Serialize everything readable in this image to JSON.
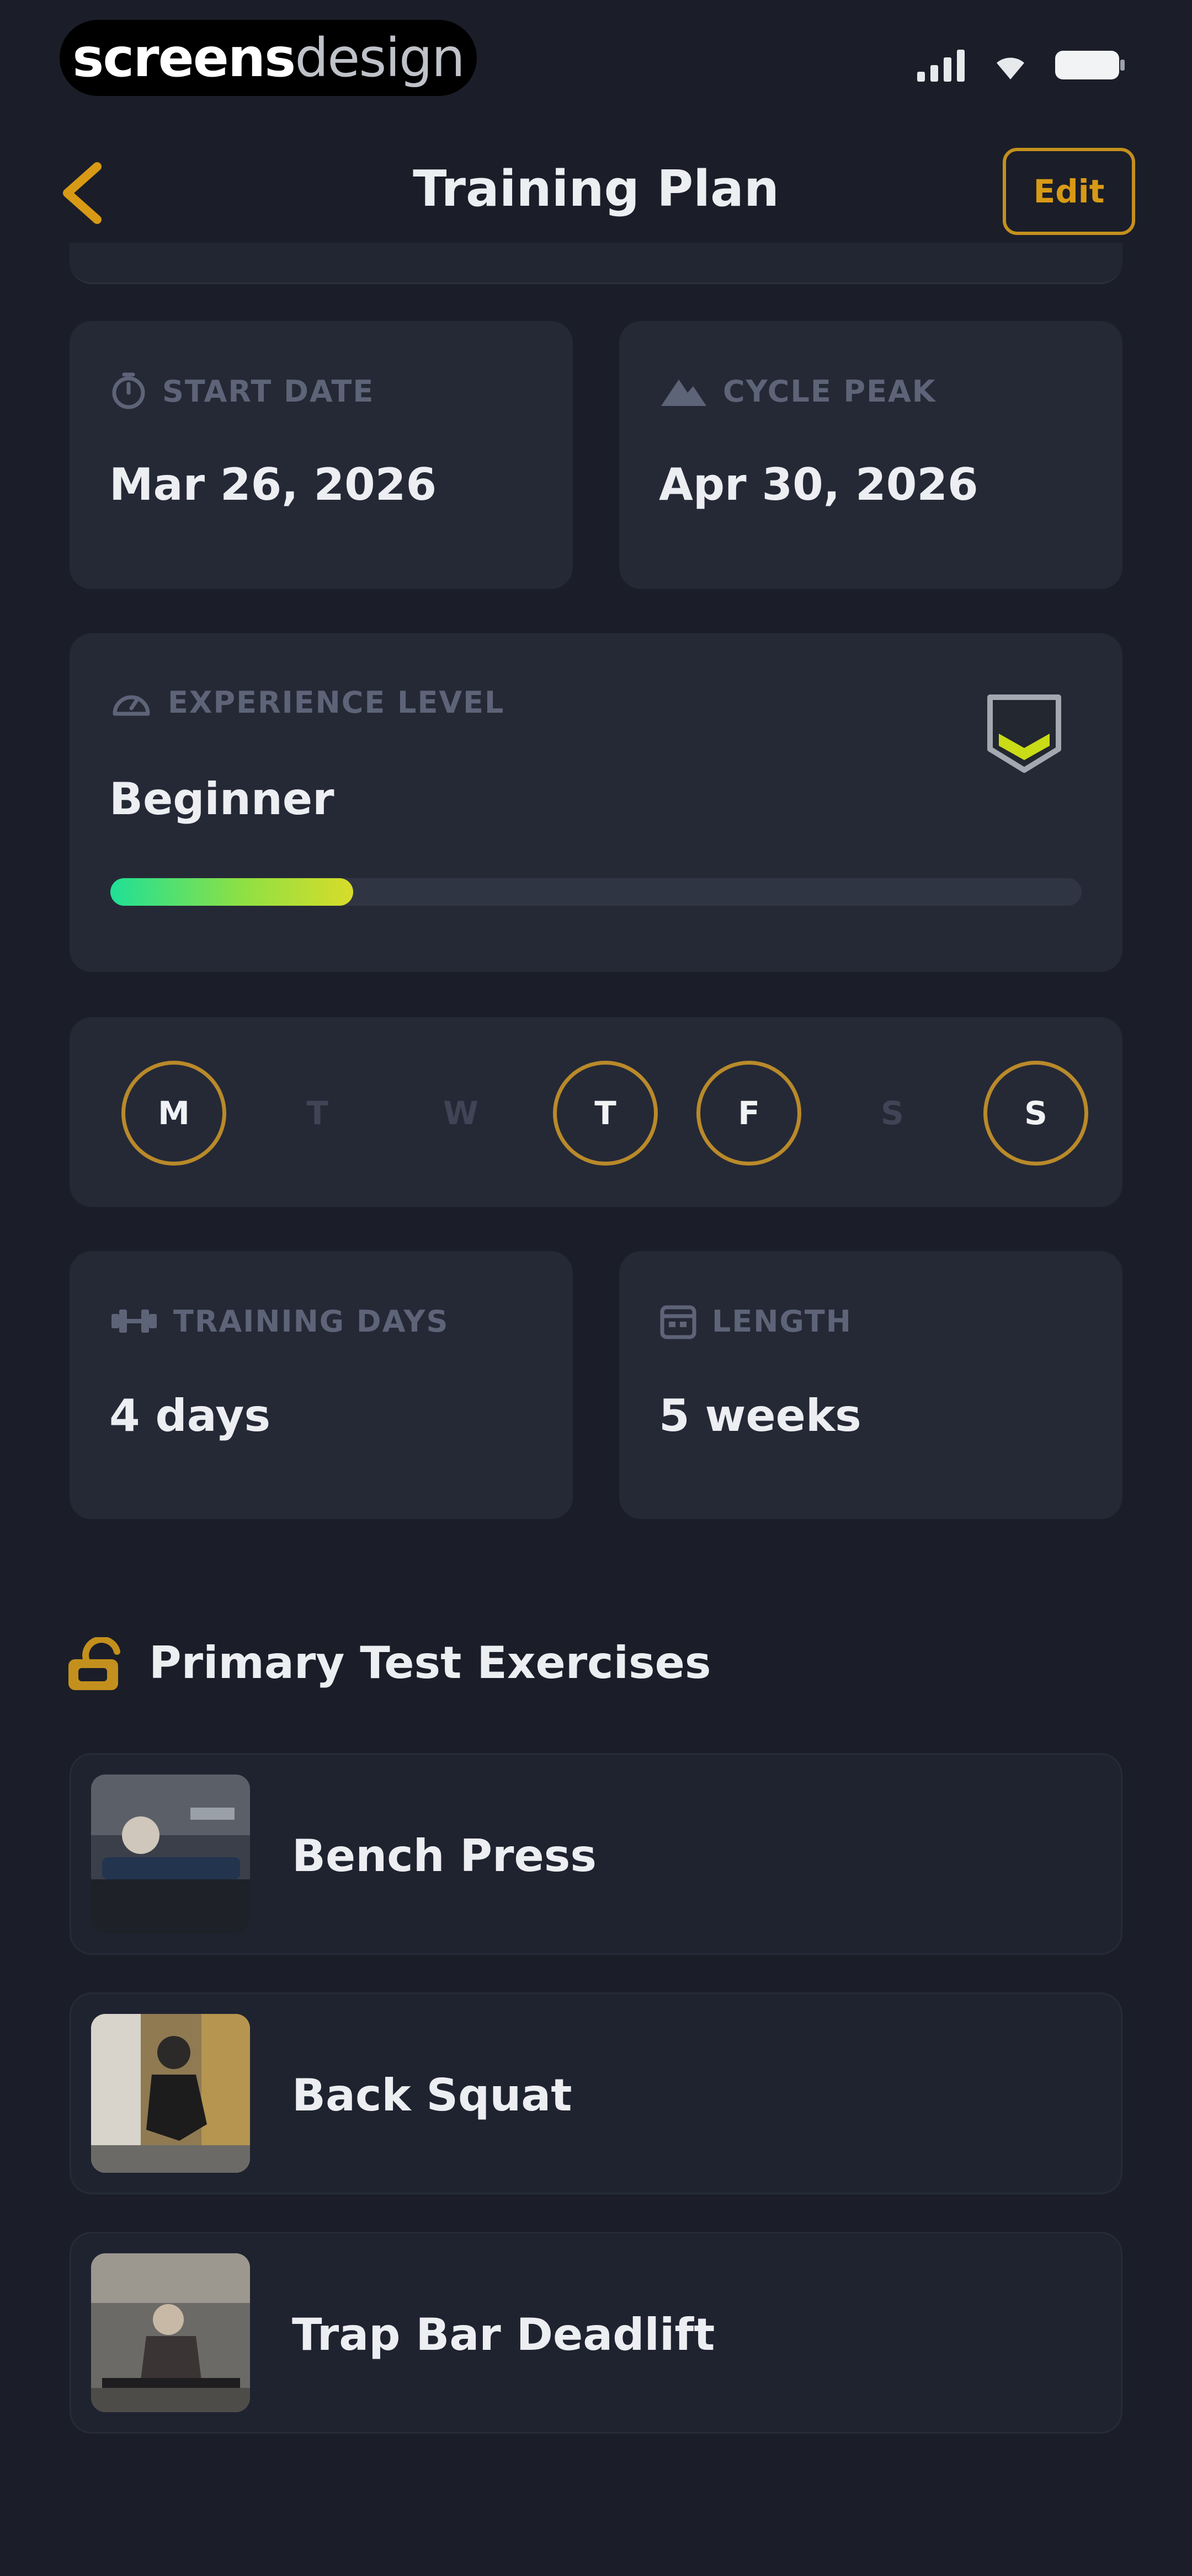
{
  "status_bar": {
    "brand_part1": "screens",
    "brand_part2": "design"
  },
  "header": {
    "title": "Training Plan",
    "edit_label": "Edit"
  },
  "start_date": {
    "label": "START DATE",
    "value": "Mar 26, 2026"
  },
  "cycle_peak": {
    "label": "CYCLE PEAK",
    "value": "Apr 30, 2026"
  },
  "experience": {
    "label": "EXPERIENCE LEVEL",
    "value": "Beginner",
    "progress_percent": 25
  },
  "week_days": [
    {
      "letter": "M",
      "active": true
    },
    {
      "letter": "T",
      "active": false
    },
    {
      "letter": "W",
      "active": false
    },
    {
      "letter": "T",
      "active": true
    },
    {
      "letter": "F",
      "active": true
    },
    {
      "letter": "S",
      "active": false
    },
    {
      "letter": "S",
      "active": true
    }
  ],
  "training_days": {
    "label": "TRAINING DAYS",
    "value": "4 days"
  },
  "length": {
    "label": "LENGTH",
    "value": "5 weeks"
  },
  "primary_tests": {
    "title": "Primary Test Exercises",
    "exercises": [
      {
        "name": "Bench Press"
      },
      {
        "name": "Back Squat"
      },
      {
        "name": "Trap Bar Deadlift"
      }
    ]
  },
  "colors": {
    "accent": "#d89a15",
    "background": "#1b1e29",
    "card": "#252936",
    "progress_start": "#1fe096",
    "progress_end": "#d8dc2a"
  }
}
